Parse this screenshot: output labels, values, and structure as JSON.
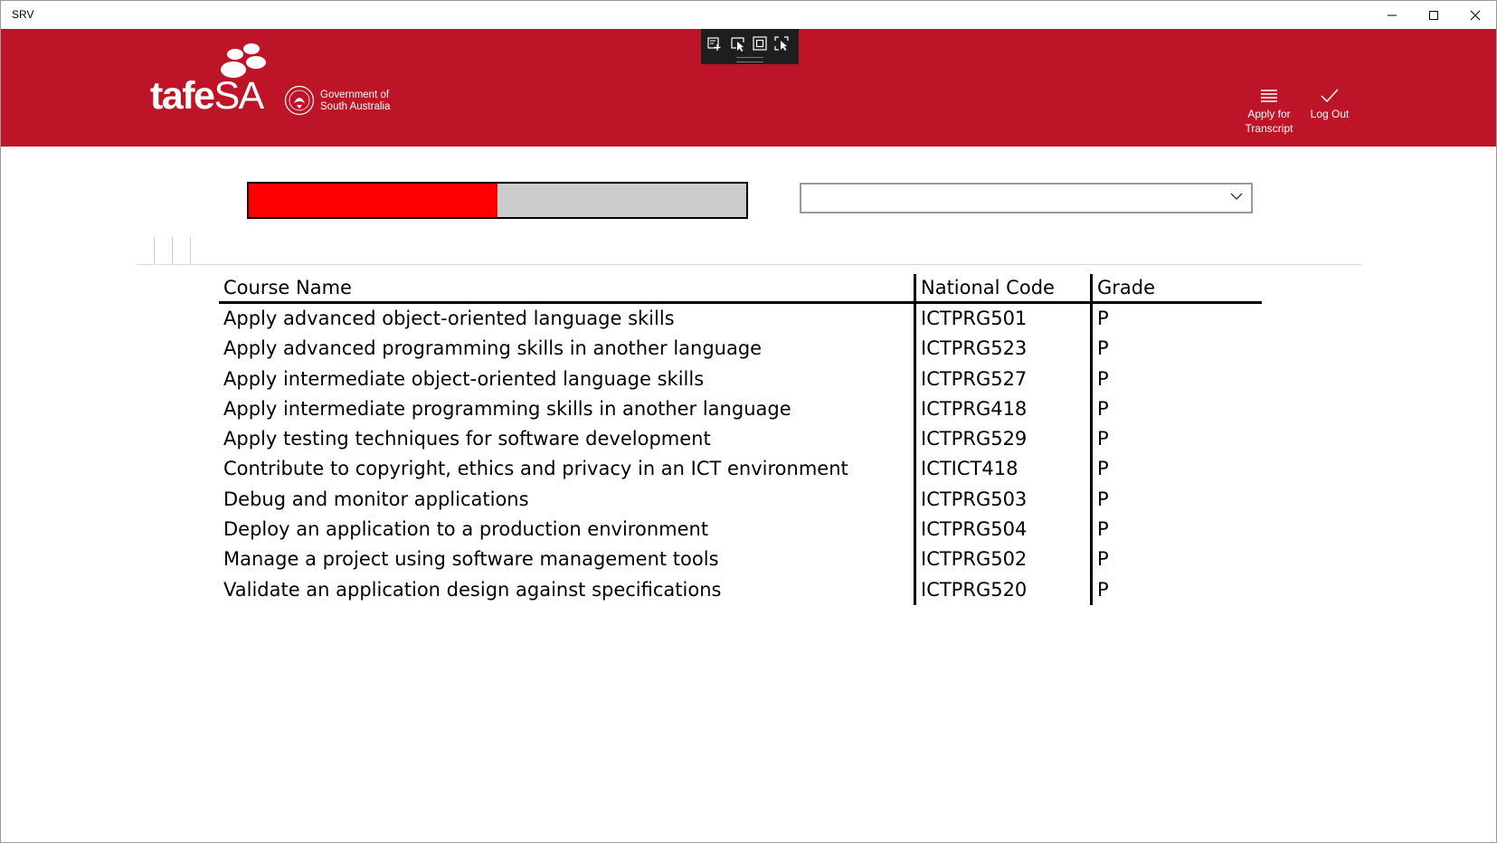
{
  "window": {
    "title": "SRV"
  },
  "header": {
    "logo_word": "tafe",
    "logo_sa": "SA",
    "gov_line1": "Government of",
    "gov_line2": "South Australia",
    "apply_line1": "Apply for",
    "apply_line2": "Transcript",
    "logout_label": "Log Out",
    "color": "#be1428"
  },
  "progress": {
    "value_percent": 50,
    "fill_color": "#ff0000",
    "track_color": "#cccccc"
  },
  "dropdown": {
    "selected": ""
  },
  "table": {
    "headers": {
      "name": "Course Name",
      "code": "National Code",
      "grade": "Grade"
    },
    "rows": [
      {
        "name": "Apply advanced object-oriented language skills",
        "code": "ICTPRG501",
        "grade": "P"
      },
      {
        "name": "Apply advanced programming skills in another language",
        "code": "ICTPRG523",
        "grade": "P"
      },
      {
        "name": "Apply intermediate object-oriented language skills",
        "code": "ICTPRG527",
        "grade": "P"
      },
      {
        "name": "Apply intermediate programming skills in another language",
        "code": "ICTPRG418",
        "grade": "P"
      },
      {
        "name": "Apply testing techniques for software development",
        "code": "ICTPRG529",
        "grade": "P"
      },
      {
        "name": "Contribute to copyright, ethics and privacy in an ICT environment",
        "code": "ICTICT418",
        "grade": "P"
      },
      {
        "name": "Debug and monitor applications",
        "code": "ICTPRG503",
        "grade": "P"
      },
      {
        "name": "Deploy an application to a production environment",
        "code": "ICTPRG504",
        "grade": "P"
      },
      {
        "name": "Manage a project using software management tools",
        "code": "ICTPRG502",
        "grade": "P"
      },
      {
        "name": "Validate an application design against specifications",
        "code": "ICTPRG520",
        "grade": "P"
      }
    ]
  }
}
